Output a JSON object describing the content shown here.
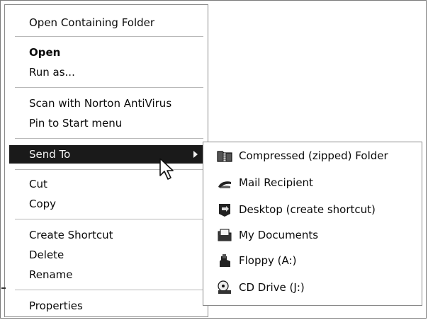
{
  "context_menu": {
    "items": [
      {
        "label": "Open Containing Folder"
      },
      {
        "label": "Open"
      },
      {
        "label": "Run as..."
      },
      {
        "label": "Scan with Norton AntiVirus"
      },
      {
        "label": "Pin to Start menu"
      },
      {
        "label": "Send To"
      },
      {
        "label": "Cut"
      },
      {
        "label": "Copy"
      },
      {
        "label": "Create Shortcut"
      },
      {
        "label": "Delete"
      },
      {
        "label": "Rename"
      },
      {
        "label": "Properties"
      }
    ],
    "selected_item": "Send To",
    "default_item": "Open"
  },
  "send_to_submenu": {
    "items": [
      {
        "label": "Compressed (zipped) Folder",
        "icon": "zip-folder-icon"
      },
      {
        "label": "Mail Recipient",
        "icon": "mail-icon"
      },
      {
        "label": "Desktop (create shortcut)",
        "icon": "desktop-icon"
      },
      {
        "label": "My Documents",
        "icon": "my-documents-icon"
      },
      {
        "label": "Floppy (A:)",
        "icon": "floppy-icon"
      },
      {
        "label": "CD Drive (J:)",
        "icon": "cd-drive-icon"
      }
    ]
  },
  "colors": {
    "selection_background": "#1a1a1a",
    "selection_text": "#f2f2f2",
    "menu_background": "#ffffff"
  }
}
